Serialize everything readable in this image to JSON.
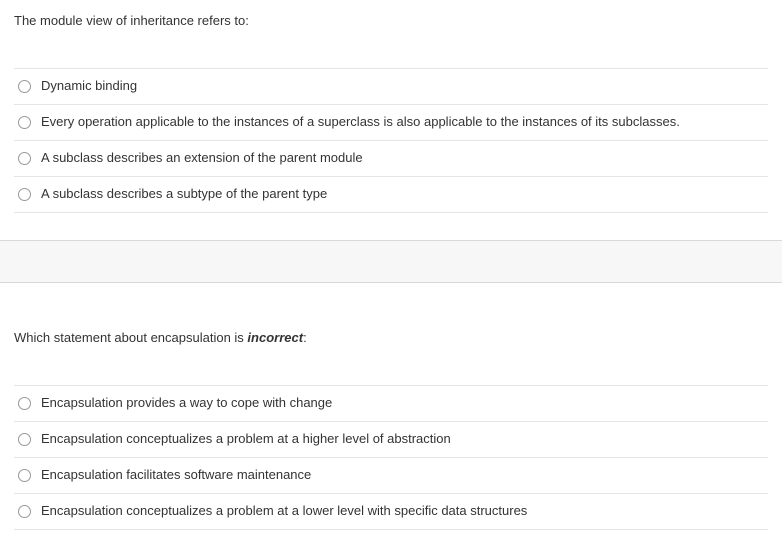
{
  "questions": [
    {
      "prompt": "The module view of inheritance refers to:",
      "prompt_emph": "",
      "options": [
        "Dynamic binding",
        "Every operation applicable to the instances of a superclass is also applicable to the instances of its subclasses.",
        "A subclass describes an extension of the parent module",
        "A subclass describes a subtype of the parent type"
      ]
    },
    {
      "prompt": "Which statement about encapsulation is ",
      "prompt_emph": "incorrect",
      "prompt_suffix": ":",
      "options": [
        "Encapsulation provides a way to cope with change",
        "Encapsulation conceptualizes a problem at a higher level of abstraction",
        "Encapsulation facilitates software maintenance",
        "Encapsulation conceptualizes a problem at a lower level with specific data structures"
      ]
    }
  ]
}
